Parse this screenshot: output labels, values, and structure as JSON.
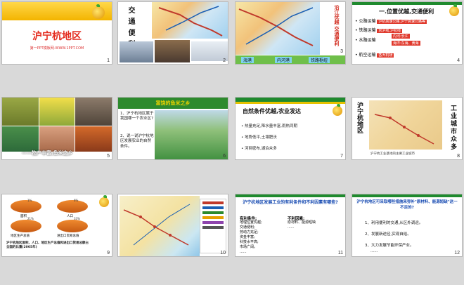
{
  "s1": {
    "title": "沪宁杭地区",
    "sub": "第一PPT模板网-WWW.1PPT.COM",
    "num": "1"
  },
  "s2": {
    "vtitle": "交通便利",
    "num": "2"
  },
  "s3": {
    "vtitle": "沿江优越 交通便利",
    "legend": [
      "海港",
      "内河港",
      "铁路枢纽"
    ],
    "num": "3"
  },
  "s4": {
    "heading": "一.位置优越,交通便利",
    "rows": [
      {
        "k": "公路运输",
        "v": [
          "沪杭高速公路,沪宁高速公路等"
        ]
      },
      {
        "k": "铁路运输",
        "v": [
          "京沪线,沪杭线"
        ]
      },
      {
        "k": "水路运输",
        "v": [
          "内河:长江",
          "海洋:东海、黄海"
        ]
      },
      {
        "k": "航空运输",
        "v": [
          "各大机场"
        ]
      }
    ],
    "num": "4"
  },
  "s5": {
    "caption": "——物产丰富,鱼米之乡",
    "num": "5"
  },
  "s6": {
    "title": "富饶的鱼米之乡",
    "q1": "1、沪宁杭地区属于我国哪一个农业区?",
    "q2": "2、说一说沪宁杭地区发展农业的自然条件。",
    "num": "6"
  },
  "s7": {
    "title": "自然条件优越,农业发达",
    "items": [
      "热量充足,降水量丰富,雨热同期",
      "地势低平,土壤肥沃",
      "河网密布,湖泊众多"
    ],
    "num": "7"
  },
  "s8": {
    "vleft": "沪宁杭地区",
    "vright": "工业城市众多",
    "caption": "沪宁杭工业基地的主要工业城市",
    "num": "8"
  },
  "s9": {
    "labels": [
      "面积",
      "人口",
      "地区生产总值",
      "进出口贸易总值"
    ],
    "pcts": [
      "1%",
      "6%",
      "21%",
      "33%"
    ],
    "caption": "沪宁杭地区面积、人口、地区生产总值和进出口贸易总额占全国的比重(2005年)",
    "num": "9"
  },
  "s10": {
    "num": "10"
  },
  "s11": {
    "title": "沪宁杭地区发展工业的有利条件和不利因素有哪些?",
    "good_h": "有利条件:",
    "good": [
      "地理位置优越;",
      "交通便利;",
      "劳动力充足;",
      "资金丰富;",
      "科技水平高;",
      "市场广阔。",
      "......"
    ],
    "bad_h": "不利因素:",
    "bad": [
      "原材料、能源短缺",
      "......"
    ],
    "num": "11"
  },
  "s12": {
    "title": "沪宁杭地区可采取哪些措施来弥补\"原材料、能源短缺\"这一不足的?",
    "items": [
      "1、利用便利的交通,从区外调运。",
      "2、发展新途径,实现自给。",
      "3、大力发展节能环保产业。",
      "......"
    ],
    "num": "12"
  }
}
